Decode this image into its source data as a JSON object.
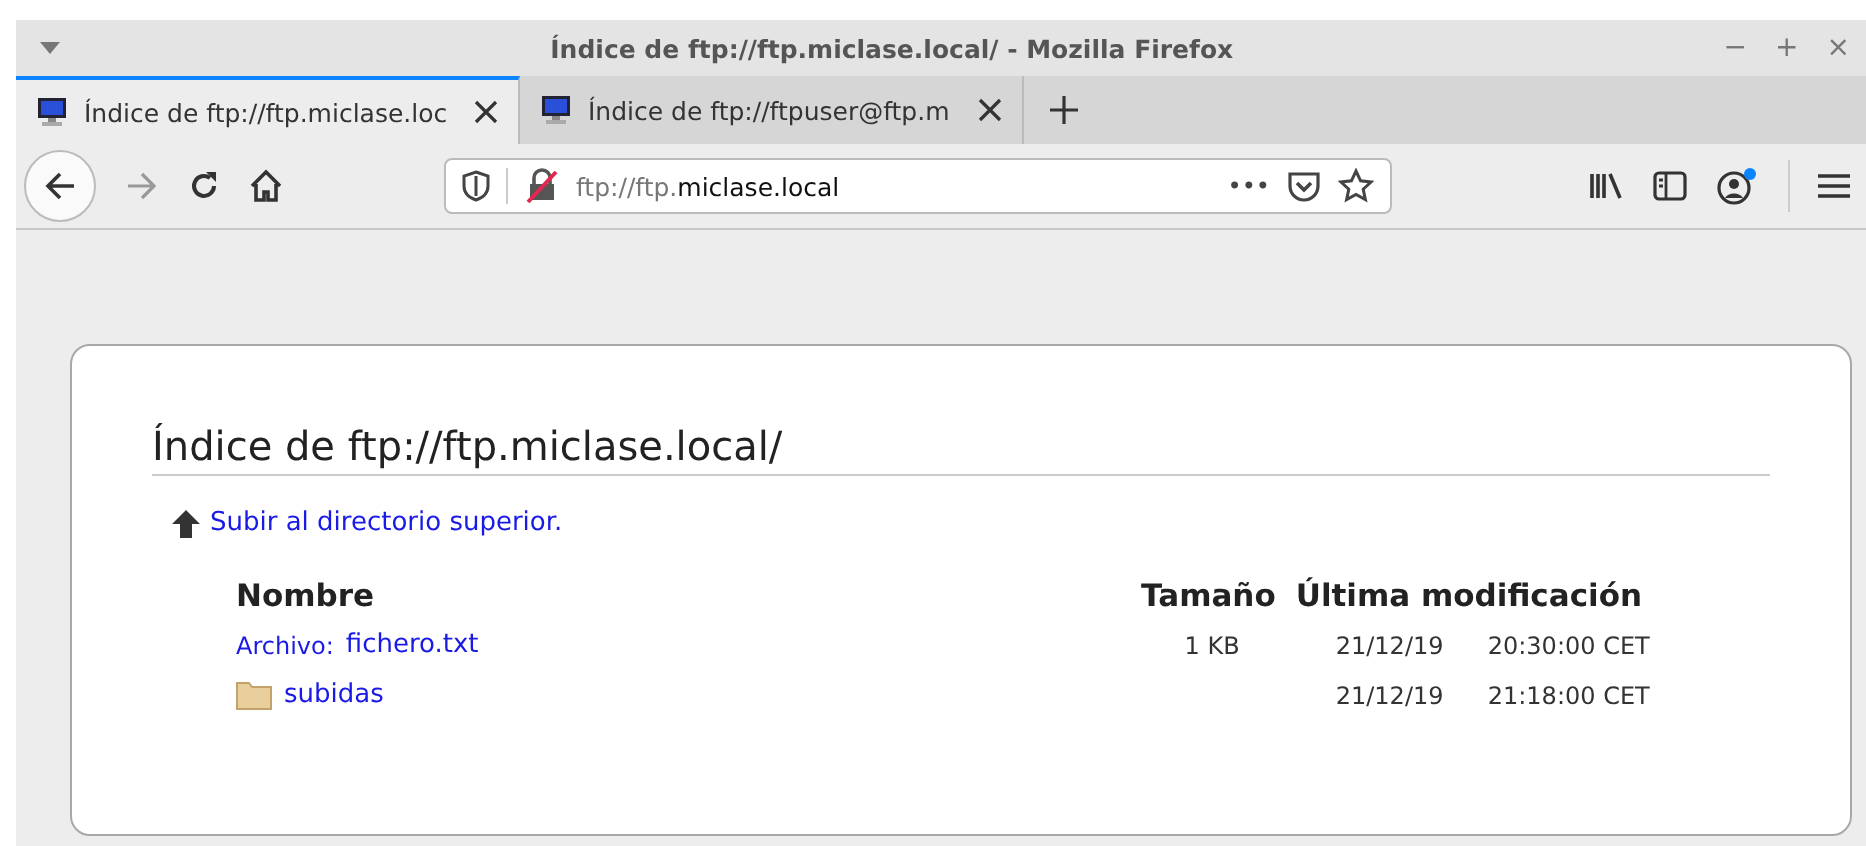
{
  "window": {
    "title": "Índice de ftp://ftp.miclase.local/ - Mozilla Firefox",
    "controls": [
      "−",
      "+",
      "×"
    ]
  },
  "tabs": [
    {
      "label": "Índice de ftp://ftp.miclase.loc",
      "selected": true
    },
    {
      "label": "Índice de ftp://ftpuser@ftp.m",
      "selected": false
    }
  ],
  "address_bar": {
    "url_prefix": "ftp://ftp.",
    "url_host": "miclase.local",
    "page_actions": "•••"
  },
  "page": {
    "heading": "Índice de ftp://ftp.miclase.local/",
    "parent_link": "Subir al directorio superior.",
    "table": {
      "columns": [
        "Nombre",
        "Tamaño",
        "Última modificación"
      ],
      "rows": [
        {
          "kind": "file",
          "prefix": "Archivo:",
          "name": "fichero.txt",
          "size": "1 KB",
          "date": "21/12/19",
          "time": "20:30:00 CET"
        },
        {
          "kind": "folder",
          "name": "subidas",
          "date": "21/12/19",
          "time": "21:18:00 CET"
        }
      ]
    }
  }
}
